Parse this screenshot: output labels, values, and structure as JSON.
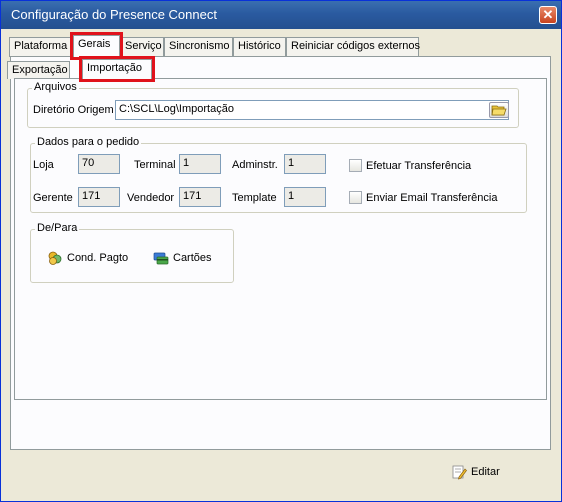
{
  "window": {
    "title": "Configuração do Presence Connect",
    "close_label": "✕"
  },
  "tabs": [
    {
      "label": "Plataforma"
    },
    {
      "label": "Gerais"
    },
    {
      "label": "Serviço"
    },
    {
      "label": "Sincronismo"
    },
    {
      "label": "Histórico"
    },
    {
      "label": "Reiniciar códigos externos"
    }
  ],
  "subtabs": [
    {
      "label": "Exportação"
    },
    {
      "label": "Importação"
    }
  ],
  "arquivos": {
    "title": "Arquivos",
    "dir_label": "Diretório Origem",
    "dir_value": "C:\\SCL\\Log\\Importação"
  },
  "dados": {
    "title": "Dados para o pedido",
    "loja_label": "Loja",
    "loja_value": "70",
    "terminal_label": "Terminal",
    "terminal_value": "1",
    "adminstr_label": "Adminstr.",
    "adminstr_value": "1",
    "gerente_label": "Gerente",
    "gerente_value": "171",
    "vendedor_label": "Vendedor",
    "vendedor_value": "171",
    "template_label": "Template",
    "template_value": "1",
    "efetuar_label": "Efetuar Transferência",
    "enviar_label": "Enviar Email Transferência"
  },
  "depara": {
    "title": "De/Para",
    "cond_label": "Cond. Pagto",
    "cartoes_label": "Cartões"
  },
  "footer": {
    "editar_label": "Editar"
  }
}
